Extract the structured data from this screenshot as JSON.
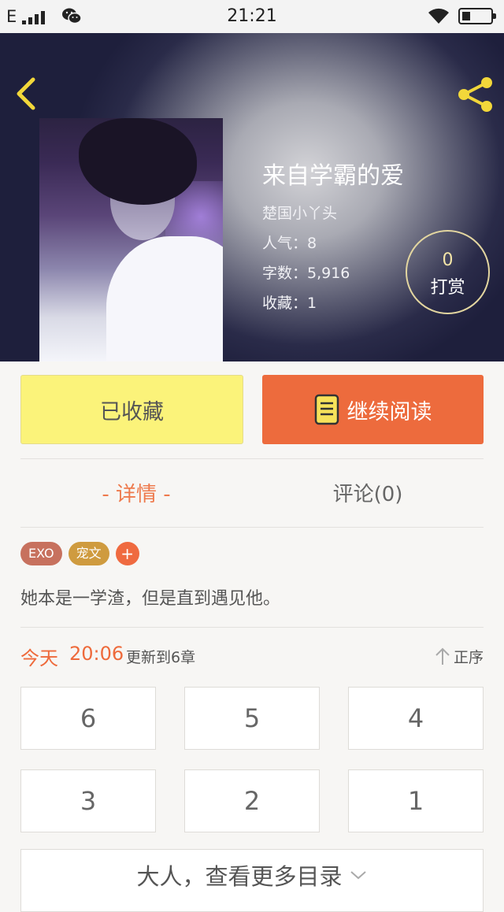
{
  "status_bar": {
    "carrier": "E",
    "time": "21:21"
  },
  "header": {
    "back_icon": "chevron-left-icon",
    "share_icon": "share-icon"
  },
  "book": {
    "title": "来自学霸的爱",
    "author": "楚国小丫头",
    "popularity": "人气：8",
    "word_count": "字数：5,916",
    "favorites": "收藏：1"
  },
  "tip": {
    "count": "0",
    "label": "打赏"
  },
  "actions": {
    "favorited_label": "已收藏",
    "continue_label": "继续阅读"
  },
  "colors": {
    "accent": "#ee6a3b",
    "favorite_button": "#fbf37a",
    "read_button": "#ed6b3d"
  },
  "tabs": [
    {
      "label": "- 详情 -",
      "active": true
    },
    {
      "label": "评论(0)",
      "active": false
    }
  ],
  "tags": [
    {
      "label": "EXO"
    },
    {
      "label": "宠文"
    },
    {
      "label": "+"
    }
  ],
  "summary": "她本是一学渣，但是直到遇见他。",
  "update": {
    "day": "今天",
    "time": "20:06",
    "note": "更新到6章",
    "sort_label": "正序"
  },
  "chapters": [
    {
      "label": "6"
    },
    {
      "label": "5"
    },
    {
      "label": "4"
    },
    {
      "label": "3"
    },
    {
      "label": "2"
    },
    {
      "label": "1"
    }
  ],
  "more_label": "大人，查看更多目录"
}
